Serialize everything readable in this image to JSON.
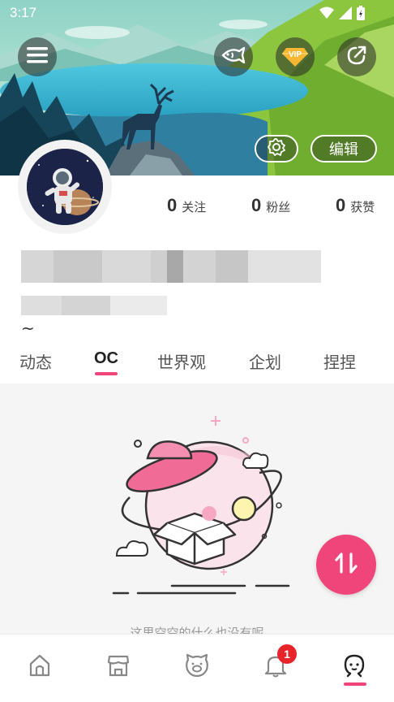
{
  "status_bar": {
    "time": "3:17"
  },
  "header": {
    "menu_icon": "hamburger-menu-icon",
    "fish_icon": "fish-icon",
    "vip_label": "VIP",
    "share_icon": "share-icon",
    "settings_icon": "gear-icon",
    "edit_label": "编辑"
  },
  "profile": {
    "tilde": "~"
  },
  "stats": {
    "following": {
      "value": "0",
      "label": "关注"
    },
    "fans": {
      "value": "0",
      "label": "粉丝"
    },
    "likes": {
      "value": "0",
      "label": "获赞"
    }
  },
  "tabs": [
    {
      "label": "动态",
      "active": false
    },
    {
      "label": "OC",
      "active": true
    },
    {
      "label": "世界观",
      "active": false
    },
    {
      "label": "企划",
      "active": false
    },
    {
      "label": "捏捏",
      "active": false
    }
  ],
  "content": {
    "empty_message": "这里空空的什么也没有呢"
  },
  "bottom_nav": {
    "items": [
      {
        "icon": "home-icon"
      },
      {
        "icon": "shop-icon"
      },
      {
        "icon": "pet-face-icon"
      },
      {
        "icon": "bell-icon",
        "badge": "1"
      },
      {
        "icon": "profile-face-icon",
        "active": true
      }
    ]
  },
  "colors": {
    "accent": "#f0457a",
    "badge": "#e8242b"
  }
}
